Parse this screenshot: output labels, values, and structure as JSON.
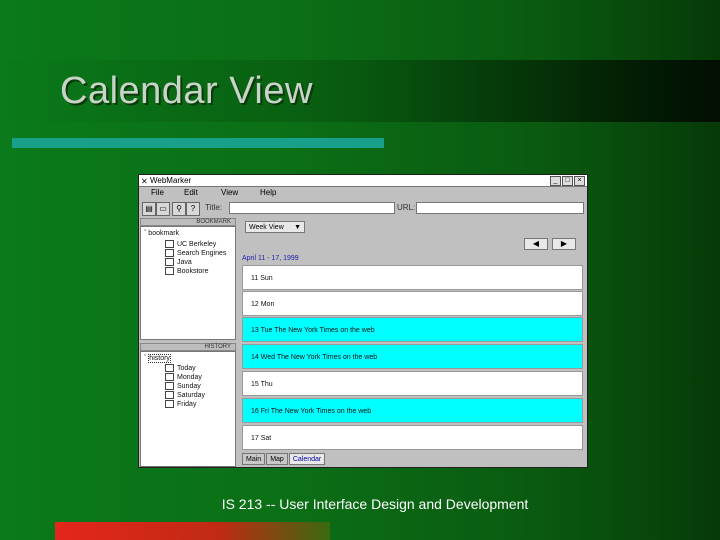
{
  "slide": {
    "title": "Calendar View",
    "footer": "IS 213 -- User Interface Design and Development"
  },
  "window": {
    "title": "WebMarker",
    "controls": [
      "_",
      "□",
      "×"
    ]
  },
  "menu": [
    "File",
    "Edit",
    "View",
    "Help"
  ],
  "toolbar": {
    "title_label": "Title:",
    "url_label": "URL:",
    "title_value": "",
    "url_value": ""
  },
  "bookmarks": {
    "header": "BOOKMARK",
    "root": "bookmark",
    "items": [
      "UC Berkeley",
      "Search Engines",
      "Java",
      "Bookstore"
    ]
  },
  "history": {
    "header": "HISTORY",
    "root": "history",
    "items": [
      "Today",
      "Monday",
      "Sunday",
      "Saturday",
      "Friday"
    ]
  },
  "calendar": {
    "view_select": "Week View",
    "prev": "◀",
    "next": "▶",
    "range": "April 11 - 17, 1999",
    "days": [
      {
        "label": "11 Sun",
        "highlight": false
      },
      {
        "label": "12 Mon",
        "highlight": false
      },
      {
        "label": "13 Tue   The New York Times on the web",
        "highlight": true
      },
      {
        "label": "14 Wed   The New York Times on the web",
        "highlight": true
      },
      {
        "label": "15 Thu",
        "highlight": false
      },
      {
        "label": "16 Fri   The New York Times on the web",
        "highlight": true
      },
      {
        "label": "17 Sat",
        "highlight": false
      }
    ],
    "tabs": [
      "Main",
      "Map",
      "Calendar"
    ],
    "active_tab": "Calendar",
    "highlight_color": "#00ffff"
  }
}
